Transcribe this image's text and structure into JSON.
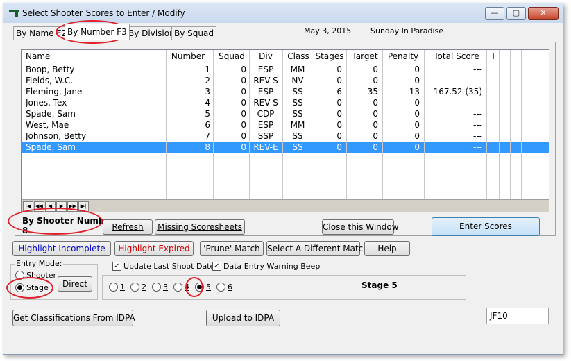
{
  "window": {
    "title": "Select Shooter Scores to Enter / Modify",
    "controls": {
      "minimize": "—",
      "maximize": "▢",
      "close": "✕"
    }
  },
  "tabs": [
    {
      "label": "By Name F2"
    },
    {
      "label": "By Number F3",
      "active": true
    },
    {
      "label": "By Division"
    },
    {
      "label": "By Squad"
    }
  ],
  "header": {
    "date": "May  3, 2015",
    "match": "Sunday In Paradise"
  },
  "table": {
    "columns": [
      "Name",
      "Number",
      "Squad",
      "Div",
      "Class",
      "Stages",
      "Target",
      "Penalty",
      "Total Score",
      "T"
    ],
    "rows": [
      {
        "name": "Boop, Betty",
        "number": "1",
        "squad": "0",
        "div": "ESP",
        "class": "MM",
        "stages": "0",
        "target": "0",
        "penalty": "0",
        "total": "---"
      },
      {
        "name": "Fields, W.C.",
        "number": "2",
        "squad": "0",
        "div": "REV-S",
        "class": "NV",
        "stages": "0",
        "target": "0",
        "penalty": "0",
        "total": "---"
      },
      {
        "name": "Fleming, Jane",
        "number": "3",
        "squad": "0",
        "div": "ESP",
        "class": "SS",
        "stages": "6",
        "target": "35",
        "penalty": "13",
        "total": "167.52 (35)"
      },
      {
        "name": "Jones, Tex",
        "number": "4",
        "squad": "0",
        "div": "REV-S",
        "class": "SS",
        "stages": "0",
        "target": "0",
        "penalty": "0",
        "total": "---"
      },
      {
        "name": "Spade, Sam",
        "number": "5",
        "squad": "0",
        "div": "CDP",
        "class": "SS",
        "stages": "0",
        "target": "0",
        "penalty": "0",
        "total": "---"
      },
      {
        "name": "West, Mae",
        "number": "6",
        "squad": "0",
        "div": "ESP",
        "class": "MM",
        "stages": "0",
        "target": "0",
        "penalty": "0",
        "total": "---"
      },
      {
        "name": "Johnson, Betty",
        "number": "7",
        "squad": "0",
        "div": "SSP",
        "class": "SS",
        "stages": "0",
        "target": "0",
        "penalty": "0",
        "total": "---"
      },
      {
        "name": "Spade, Sam",
        "number": "8",
        "squad": "0",
        "div": "REV-E",
        "class": "SS",
        "stages": "0",
        "target": "0",
        "penalty": "0",
        "total": "---",
        "selected": true
      }
    ],
    "nav": {
      "first": "|◀",
      "prev_page": "◀◀",
      "prev": "◀",
      "next": "▶",
      "next_page": "▶▶",
      "last": "▶|"
    }
  },
  "shooter_number": {
    "label": "By Shooter Number:",
    "value": "8"
  },
  "buttons": {
    "refresh": "Refresh",
    "missing": "Missing Scoresheets",
    "close_window": "Close this Window",
    "enter_scores": "Enter Scores",
    "highlight_incomplete": "Highlight Incomplete",
    "highlight_expired": "Highlight Expired",
    "prune": "'Prune' Match",
    "select_match": "Select A Different  Match",
    "help": "Help",
    "direct": "Direct",
    "get_classifications": "Get Classifications From IDPA",
    "upload": "Upload to IDPA"
  },
  "entry_mode": {
    "label": "Entry Mode:",
    "shooter": "Shooter",
    "stage": "Stage",
    "selected": "Stage"
  },
  "options": {
    "update_last_shoot": "Update Last Shoot Date",
    "warning_beep": "Data Entry Warning Beep"
  },
  "stages": {
    "options": [
      "1",
      "2",
      "3",
      "4",
      "5",
      "6"
    ],
    "selected": "5",
    "label": "Stage 5"
  },
  "code_field": {
    "value": "JF10"
  },
  "colors": {
    "selected_row": "#3399ff",
    "incomplete_text": "#0000cc",
    "expired_text": "#cc0000",
    "annotation": "#e0202a"
  }
}
